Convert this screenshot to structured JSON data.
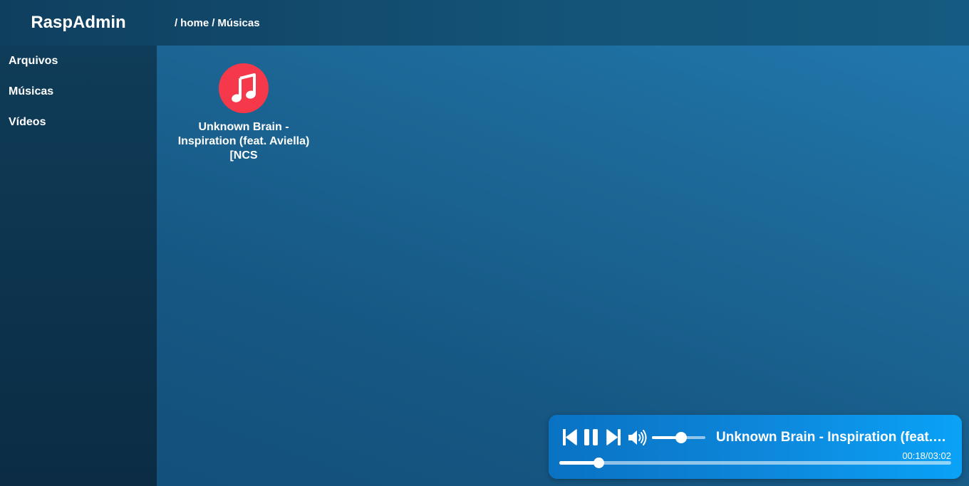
{
  "app": {
    "title": "RaspAdmin"
  },
  "breadcrumb": {
    "sep1": "/",
    "home": "home",
    "sep2": "/",
    "current": "Músicas"
  },
  "sidebar": {
    "items": [
      {
        "label": "Arquivos"
      },
      {
        "label": "Músicas"
      },
      {
        "label": "Vídeos"
      }
    ]
  },
  "files": [
    {
      "name": "Unknown Brain - Inspiration (feat. Aviella) [NCS",
      "icon": "music-note-icon",
      "icon_color": "#f6384b"
    }
  ],
  "player": {
    "title": "Unknown Brain - Inspiration (feat. Aviella) [NCS Release]",
    "time": "00:18/03:02",
    "progress": 0.1,
    "volume": 0.55,
    "state": "playing",
    "icons": [
      "skip-previous-icon",
      "pause-icon",
      "skip-next-icon",
      "volume-icon"
    ]
  }
}
